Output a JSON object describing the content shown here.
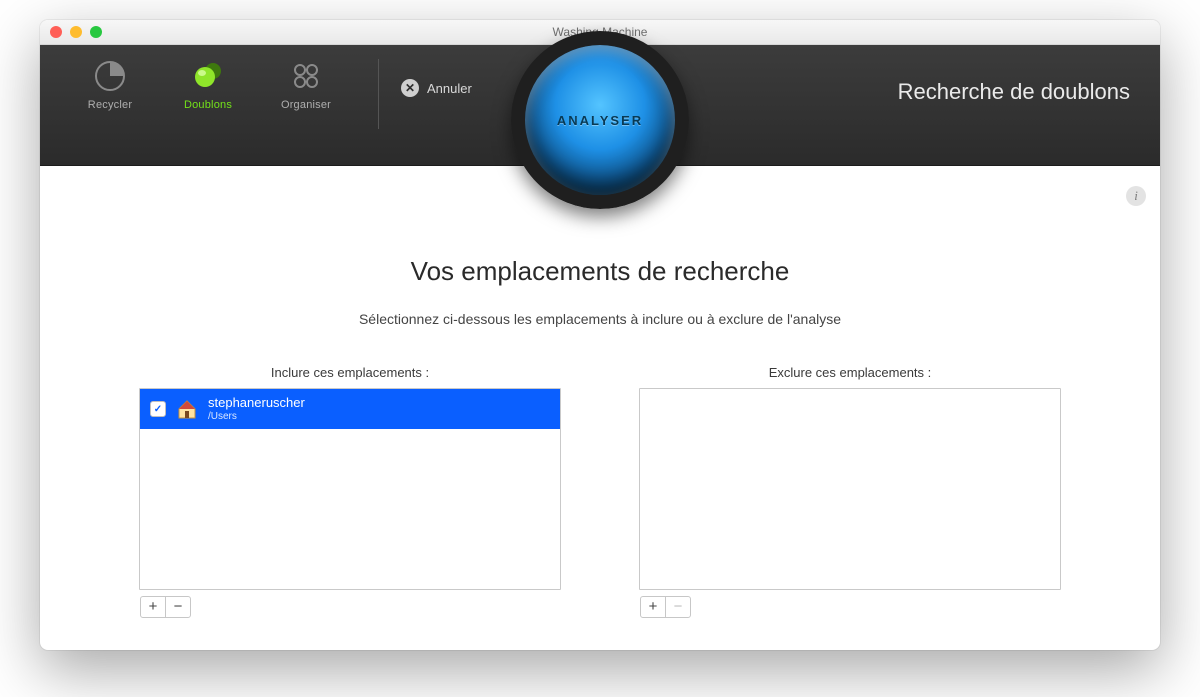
{
  "window": {
    "title": "Washing Machine"
  },
  "toolbar": {
    "tabs": [
      {
        "id": "recycler",
        "label": "Recycler",
        "active": false
      },
      {
        "id": "doublons",
        "label": "Doublons",
        "active": true
      },
      {
        "id": "organiser",
        "label": "Organiser",
        "active": false
      }
    ],
    "cancel_label": "Annuler",
    "analyse_label": "ANALYSER",
    "page_title": "Recherche de doublons"
  },
  "content": {
    "heading": "Vos emplacements de recherche",
    "subheading": "Sélectionnez ci-dessous les emplacements à inclure ou à exclure de l'analyse",
    "include": {
      "title": "Inclure ces emplacements :",
      "items": [
        {
          "name": "stephaneruscher",
          "path": "/Users",
          "checked": true,
          "selected": true
        }
      ],
      "add_enabled": true,
      "remove_enabled": true
    },
    "exclude": {
      "title": "Exclure ces emplacements :",
      "items": [],
      "add_enabled": true,
      "remove_enabled": false
    }
  }
}
